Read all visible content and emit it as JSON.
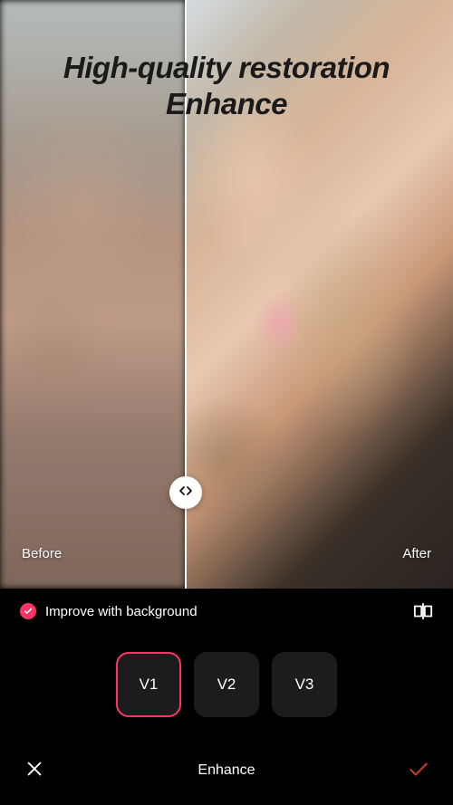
{
  "headline_line1": "High-quality restoration",
  "headline_line2": "Enhance",
  "before_label": "Before",
  "after_label": "After",
  "option": {
    "improve_bg_label": "Improve with background",
    "checked": true
  },
  "versions": [
    {
      "label": "V1",
      "selected": true
    },
    {
      "label": "V2",
      "selected": false
    },
    {
      "label": "V3",
      "selected": false
    }
  ],
  "bottom_title": "Enhance",
  "colors": {
    "accent": "#ff3366",
    "bg": "#000000",
    "card": "#1c1c1c",
    "confirm": "#c0392b"
  },
  "slider_position_percent": 41
}
